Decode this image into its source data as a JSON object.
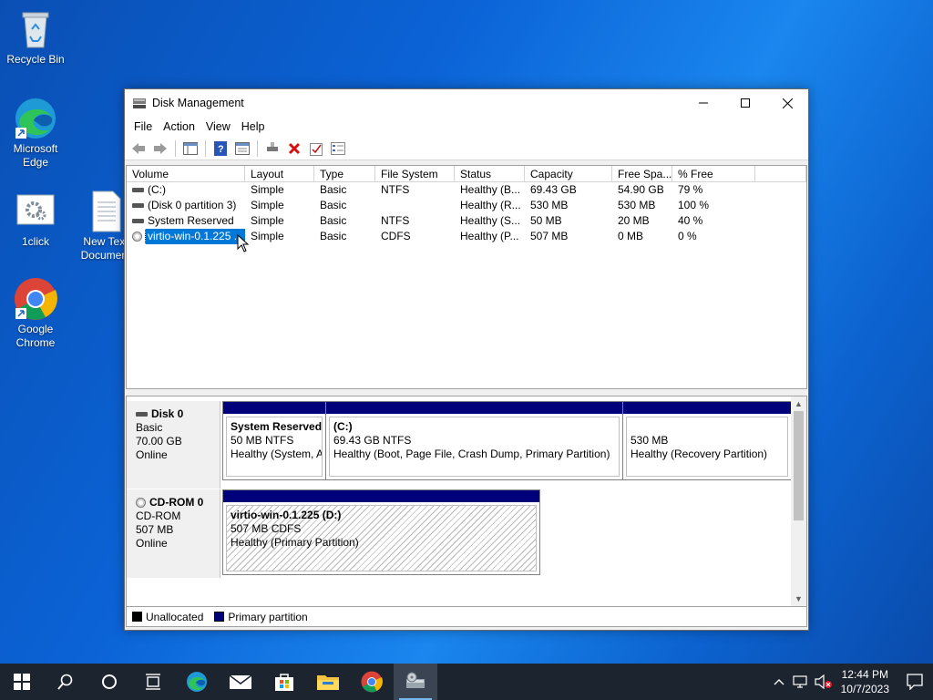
{
  "desktop": {
    "icons": [
      {
        "label": "Recycle Bin"
      },
      {
        "label": "Microsoft Edge"
      },
      {
        "label": "1click"
      },
      {
        "label": "New Text Document"
      },
      {
        "label": "Google Chrome"
      }
    ]
  },
  "window": {
    "title": "Disk Management",
    "menu": [
      "File",
      "Action",
      "View",
      "Help"
    ],
    "volume_columns": [
      "Volume",
      "Layout",
      "Type",
      "File System",
      "Status",
      "Capacity",
      "Free Spa...",
      "% Free"
    ],
    "volumes": [
      {
        "volume": "(C:)",
        "layout": "Simple",
        "type": "Basic",
        "fs": "NTFS",
        "status": "Healthy (B...",
        "capacity": "69.43 GB",
        "free": "54.90 GB",
        "pct": "79 %"
      },
      {
        "volume": "(Disk 0 partition 3)",
        "layout": "Simple",
        "type": "Basic",
        "fs": "",
        "status": "Healthy (R...",
        "capacity": "530 MB",
        "free": "530 MB",
        "pct": "100 %"
      },
      {
        "volume": "System Reserved",
        "layout": "Simple",
        "type": "Basic",
        "fs": "NTFS",
        "status": "Healthy (S...",
        "capacity": "50 MB",
        "free": "20 MB",
        "pct": "40 %"
      },
      {
        "volume": "virtio-win-0.1.225 ...",
        "layout": "Simple",
        "type": "Basic",
        "fs": "CDFS",
        "status": "Healthy (P...",
        "capacity": "507 MB",
        "free": "0 MB",
        "pct": "0 %"
      }
    ],
    "disks": [
      {
        "name": "Disk 0",
        "kind": "Basic",
        "size": "70.00 GB",
        "state": "Online",
        "partitions": [
          {
            "title": "System Reserved",
            "line2": "50 MB NTFS",
            "line3": "Healthy (System, Active, Primary Partition)"
          },
          {
            "title": "(C:)",
            "line2": "69.43 GB NTFS",
            "line3": "Healthy (Boot, Page File, Crash Dump, Primary Partition)"
          },
          {
            "title": "",
            "line2": "530 MB",
            "line3": "Healthy (Recovery Partition)"
          }
        ]
      },
      {
        "name": "CD-ROM 0",
        "kind": "CD-ROM",
        "size": "507 MB",
        "state": "Online",
        "partitions": [
          {
            "title": "virtio-win-0.1.225  (D:)",
            "line2": "507 MB CDFS",
            "line3": "Healthy (Primary Partition)"
          }
        ]
      }
    ],
    "legend": [
      {
        "label": "Unallocated",
        "color": "#000000"
      },
      {
        "label": "Primary partition",
        "color": "#00007b"
      }
    ]
  },
  "taskbar": {
    "time": "12:44 PM",
    "date": "10/7/2023"
  }
}
